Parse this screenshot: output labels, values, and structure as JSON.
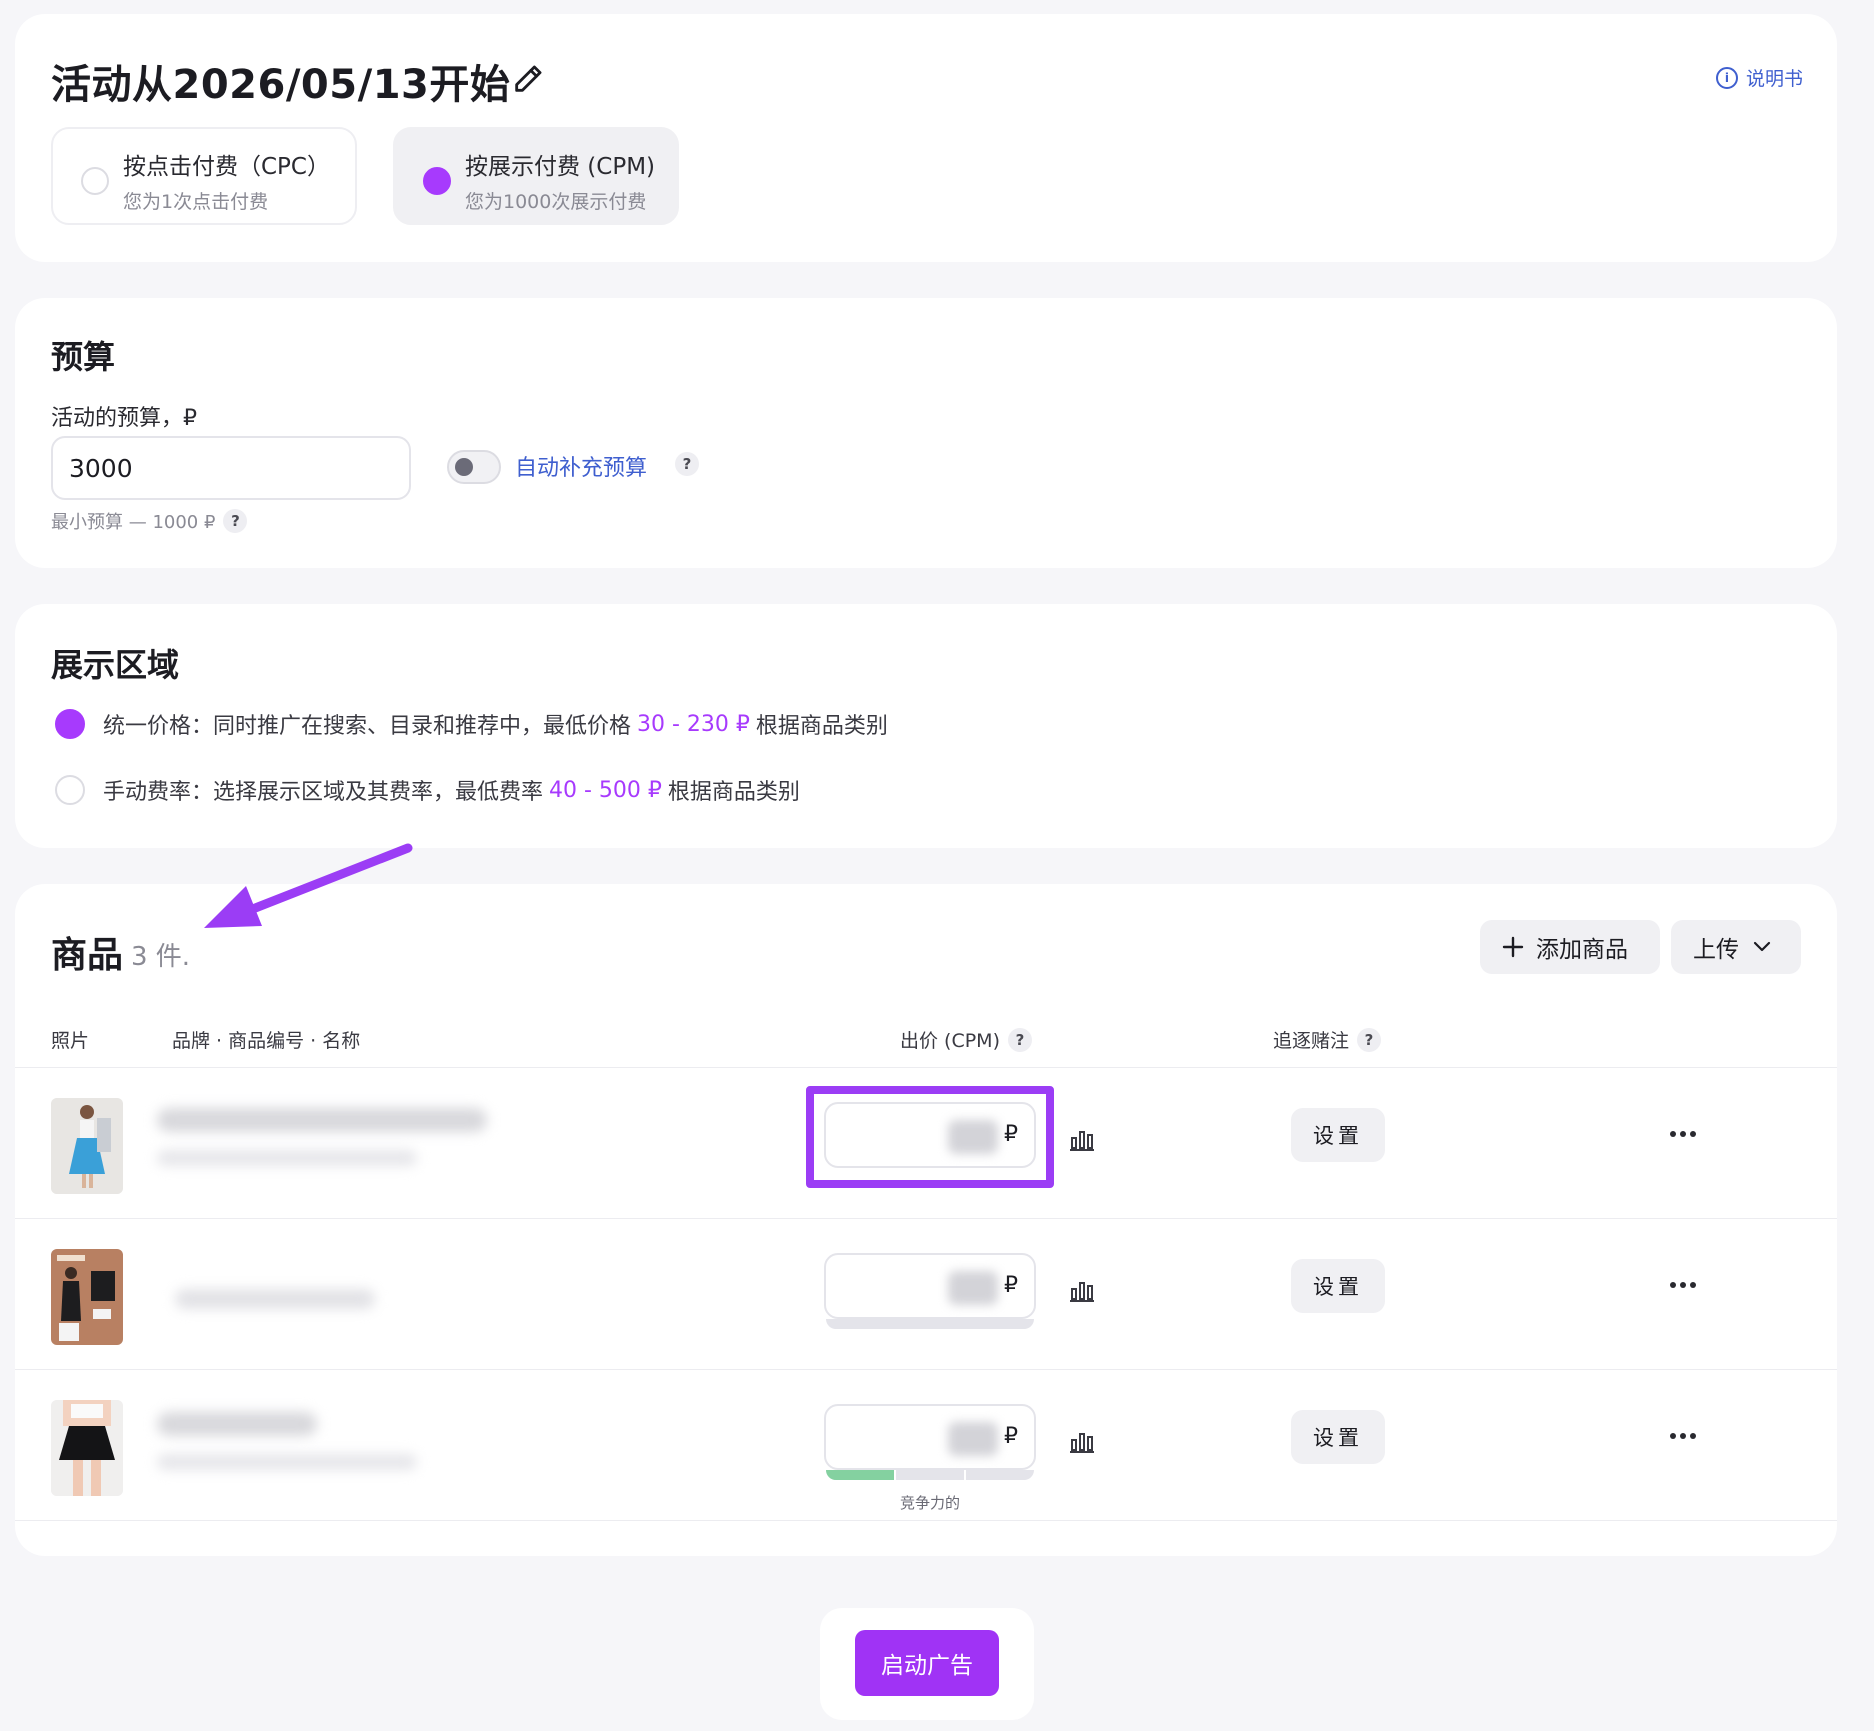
{
  "campaign": {
    "title": "活动从2026/05/13开始",
    "manual_label": "说明书",
    "payment_options": [
      {
        "label": "按点击付费（CPC）",
        "sub": "您为1次点击付费",
        "selected": false
      },
      {
        "label": "按展示付费 (CPM)",
        "sub": "您为1000次展示付费",
        "selected": true
      }
    ]
  },
  "budget": {
    "title": "预算",
    "field_label": "活动的预算，₽",
    "value": "3000",
    "min_hint": "最小预算 — 1000 ₽",
    "auto_label": "自动补充预算",
    "auto_enabled": false
  },
  "area": {
    "title": "展示区域",
    "options": [
      {
        "prefix": "统一价格：同时推广在搜索、目录和推荐中，最低价格",
        "range": "30 - 230 ₽",
        "suffix": "根据商品类别",
        "selected": true
      },
      {
        "prefix": "手动费率：选择展示区域及其费率，最低费率",
        "range": "40 - 500 ₽",
        "suffix": "根据商品类别",
        "selected": false
      }
    ]
  },
  "products": {
    "title": "商品",
    "count": "3 件.",
    "add_button": "添加商品",
    "upload_button": "上传",
    "columns": {
      "photo": "照片",
      "name": "品牌 · 商品编号 · 名称",
      "bid": "出价 (CPM)",
      "chase": "追逐赌注"
    },
    "currency": "₽",
    "settings_label": "设置",
    "rows": [
      {
        "thumb": "woman-blue-skirt",
        "bid_status": ""
      },
      {
        "thumb": "black-pencil-skirt",
        "bid_status": ""
      },
      {
        "thumb": "black-mini-skirt",
        "bid_status": "竞争力的",
        "competitiveness": 0.33
      }
    ]
  },
  "footer": {
    "start_button": "启动广告"
  },
  "colors": {
    "accent": "#a73afd",
    "link": "#3f5fcf",
    "highlight": "#9b3df5",
    "competitive": "#84d1a0"
  }
}
